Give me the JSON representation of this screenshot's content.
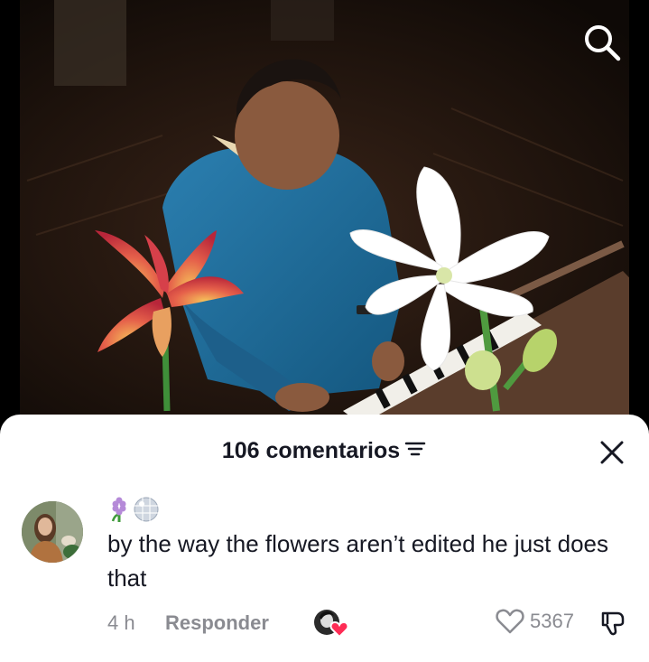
{
  "video": {
    "search_icon": "search-icon"
  },
  "comments_sheet": {
    "count_label": "106 comentarios",
    "filter_icon": "filter-icon",
    "close_icon": "close-icon"
  },
  "comment": {
    "badges": [
      "hyacinth-flower-emoji",
      "disco-ball-emoji"
    ],
    "text": "by the way the flowers aren’t edited he just does that",
    "time": "4 h",
    "reply_label": "Responder",
    "like_count": "5367",
    "colors": {
      "primary_text": "#161823",
      "secondary_text": "#8a8b91",
      "creator_heart": "#fe2c55"
    }
  }
}
